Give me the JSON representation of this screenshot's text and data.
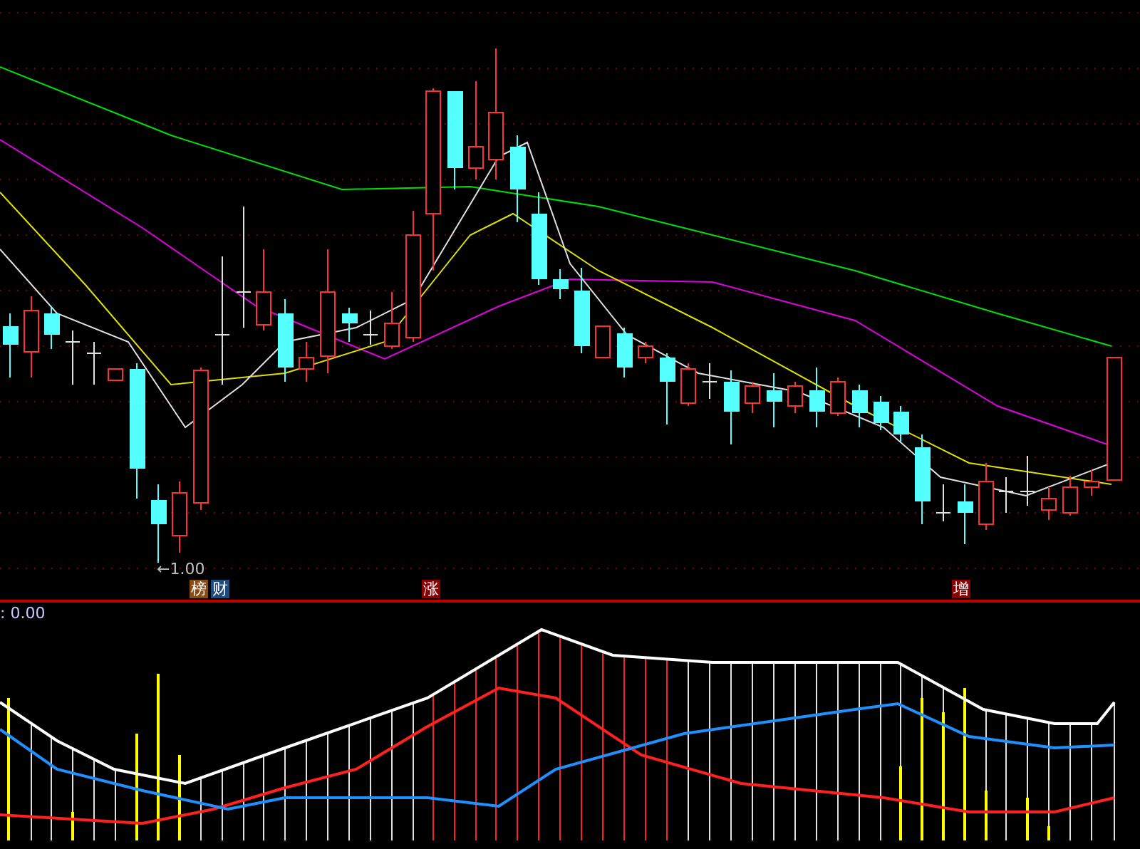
{
  "price_panel": {
    "low_marker": "←1.00",
    "tags": [
      {
        "label": "榜",
        "color": "#8b4a10"
      },
      {
        "label": "财",
        "color": "#1e4a80"
      },
      {
        "label": "涨",
        "color": "#8b0000"
      },
      {
        "label": "增",
        "color": "#8b0000"
      }
    ]
  },
  "indicator_panel": {
    "readout": ": 0.00"
  }
}
